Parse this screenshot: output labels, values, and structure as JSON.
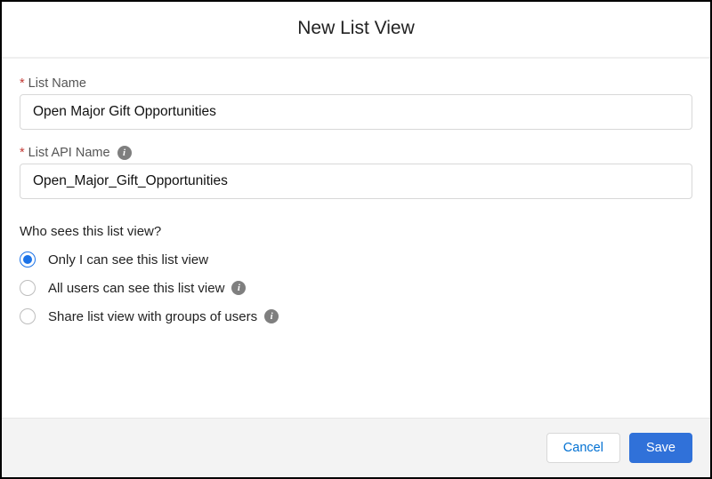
{
  "modal": {
    "title": "New List View"
  },
  "fields": {
    "listName": {
      "label": "List Name",
      "required": true,
      "value": "Open Major Gift Opportunities"
    },
    "listApiName": {
      "label": "List API Name",
      "required": true,
      "hasInfo": true,
      "value": "Open_Major_Gift_Opportunities"
    }
  },
  "visibility": {
    "question": "Who sees this list view?",
    "options": [
      {
        "label": "Only I can see this list view",
        "selected": true,
        "hasInfo": false
      },
      {
        "label": "All users can see this list view",
        "selected": false,
        "hasInfo": true
      },
      {
        "label": "Share list view with groups of users",
        "selected": false,
        "hasInfo": true
      }
    ]
  },
  "buttons": {
    "cancel": "Cancel",
    "save": "Save"
  },
  "glyphs": {
    "info": "i"
  }
}
